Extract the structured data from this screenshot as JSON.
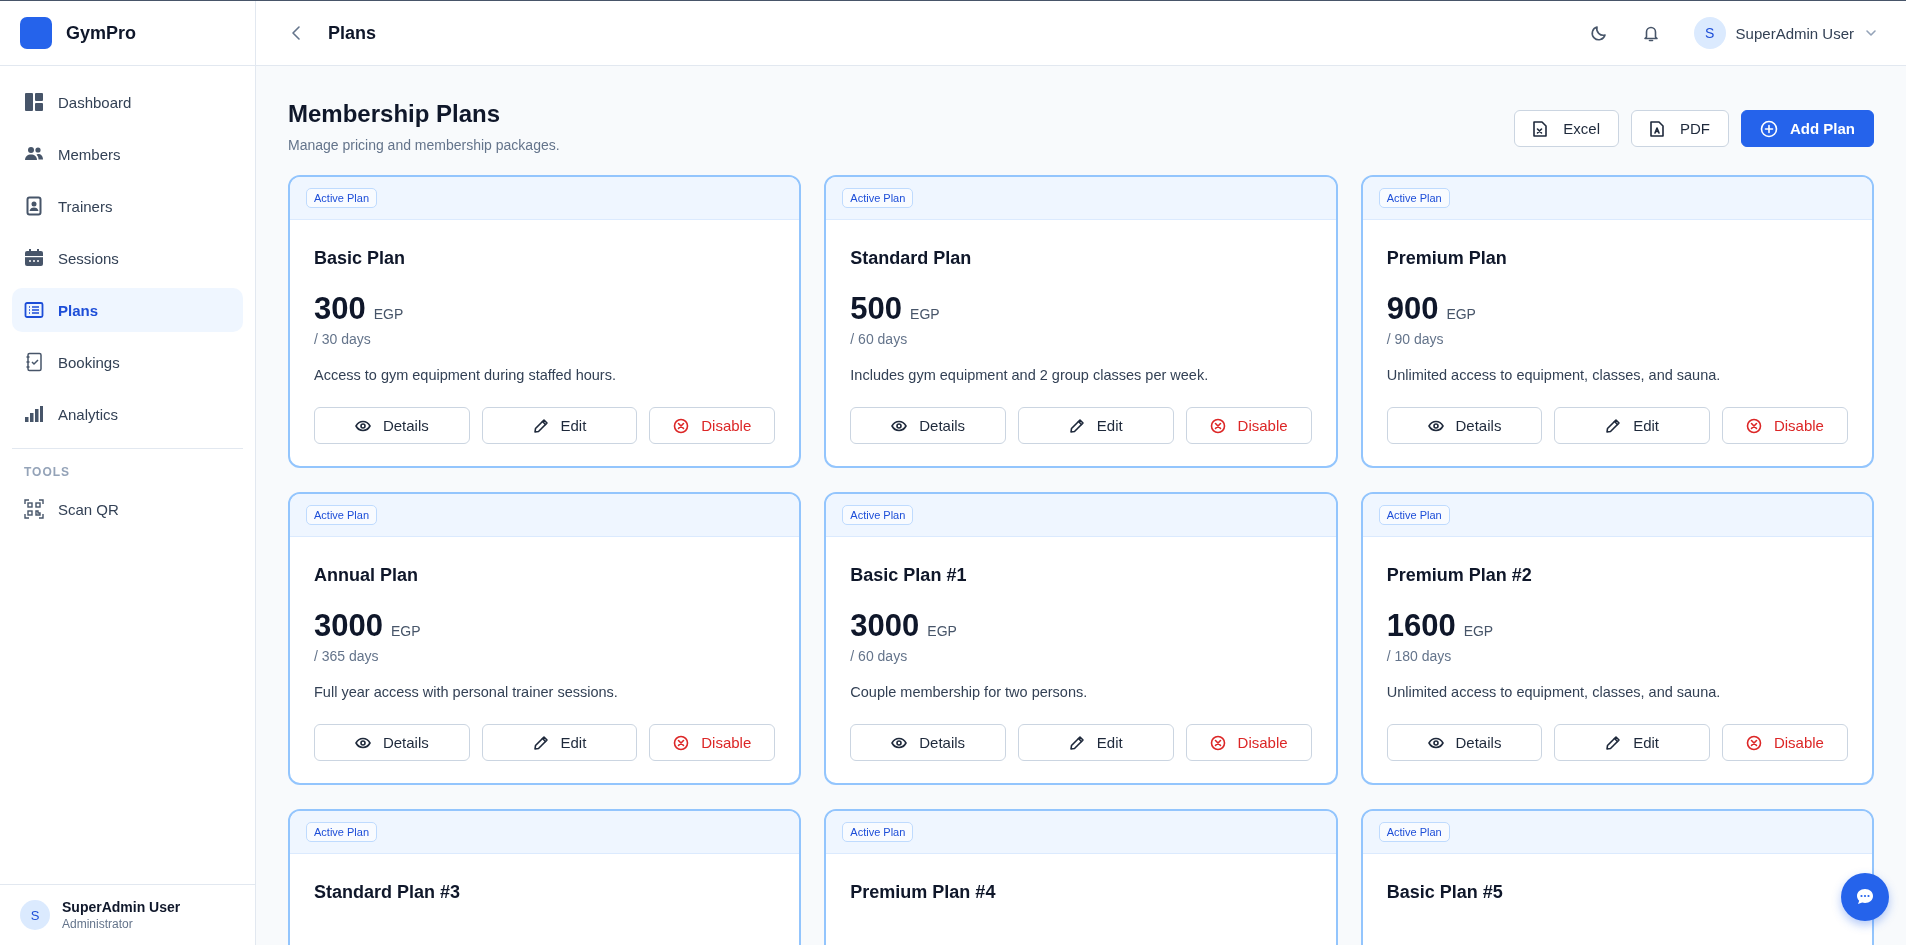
{
  "sidebar": {
    "brand": "GymPro",
    "items": [
      {
        "label": "Dashboard",
        "selected": false
      },
      {
        "label": "Members",
        "selected": false
      },
      {
        "label": "Trainers",
        "selected": false
      },
      {
        "label": "Sessions",
        "selected": false
      },
      {
        "label": "Plans",
        "selected": true
      },
      {
        "label": "Bookings",
        "selected": false
      },
      {
        "label": "Analytics",
        "selected": false
      }
    ],
    "section_label": "TOOLS",
    "tool_items": [
      {
        "label": "Scan QR",
        "selected": false
      }
    ],
    "user": {
      "initial": "S",
      "name": "SuperAdmin User",
      "role": "Administrator"
    }
  },
  "topbar": {
    "title": "Plans",
    "user": {
      "initial": "S",
      "name": "SuperAdmin User"
    }
  },
  "page": {
    "title": "Membership Plans",
    "subtitle": "Manage pricing and membership packages.",
    "actions": [
      {
        "label": "Excel",
        "kind": "excel"
      },
      {
        "label": "PDF",
        "kind": "pdf"
      },
      {
        "label": "Add Plan",
        "kind": "add"
      }
    ]
  },
  "plans": [
    {
      "badge": "Active Plan",
      "name": "Basic Plan",
      "price": "300",
      "currency": "EGP",
      "period": "/ 30 days",
      "description": "Access to gym equipment during staffed hours.",
      "actions": [
        {
          "label": "Details",
          "kind": "details"
        },
        {
          "label": "Edit",
          "kind": "edit"
        },
        {
          "label": "Disable",
          "kind": "disable"
        }
      ]
    },
    {
      "badge": "Active Plan",
      "name": "Standard Plan",
      "price": "500",
      "currency": "EGP",
      "period": "/ 60 days",
      "description": "Includes gym equipment and 2 group classes per week.",
      "actions": [
        {
          "label": "Details",
          "kind": "details"
        },
        {
          "label": "Edit",
          "kind": "edit"
        },
        {
          "label": "Disable",
          "kind": "disable"
        }
      ]
    },
    {
      "badge": "Active Plan",
      "name": "Premium Plan",
      "price": "900",
      "currency": "EGP",
      "period": "/ 90 days",
      "description": "Unlimited access to equipment, classes, and sauna.",
      "actions": [
        {
          "label": "Details",
          "kind": "details"
        },
        {
          "label": "Edit",
          "kind": "edit"
        },
        {
          "label": "Disable",
          "kind": "disable"
        }
      ]
    },
    {
      "badge": "Active Plan",
      "name": "Annual Plan",
      "price": "3000",
      "currency": "EGP",
      "period": "/ 365 days",
      "description": "Full year access with personal trainer sessions.",
      "actions": [
        {
          "label": "Details",
          "kind": "details"
        },
        {
          "label": "Edit",
          "kind": "edit"
        },
        {
          "label": "Disable",
          "kind": "disable"
        }
      ]
    },
    {
      "badge": "Active Plan",
      "name": "Basic Plan #1",
      "price": "3000",
      "currency": "EGP",
      "period": "/ 60 days",
      "description": "Couple membership for two persons.",
      "actions": [
        {
          "label": "Details",
          "kind": "details"
        },
        {
          "label": "Edit",
          "kind": "edit"
        },
        {
          "label": "Disable",
          "kind": "disable"
        }
      ]
    },
    {
      "badge": "Active Plan",
      "name": "Premium Plan #2",
      "price": "1600",
      "currency": "EGP",
      "period": "/ 180 days",
      "description": "Unlimited access to equipment, classes, and sauna.",
      "actions": [
        {
          "label": "Details",
          "kind": "details"
        },
        {
          "label": "Edit",
          "kind": "edit"
        },
        {
          "label": "Disable",
          "kind": "disable"
        }
      ]
    },
    {
      "badge": "Active Plan",
      "name": "Standard Plan #3"
    },
    {
      "badge": "Active Plan",
      "name": "Premium Plan #4"
    },
    {
      "badge": "Active Plan",
      "name": "Basic Plan #5"
    }
  ]
}
